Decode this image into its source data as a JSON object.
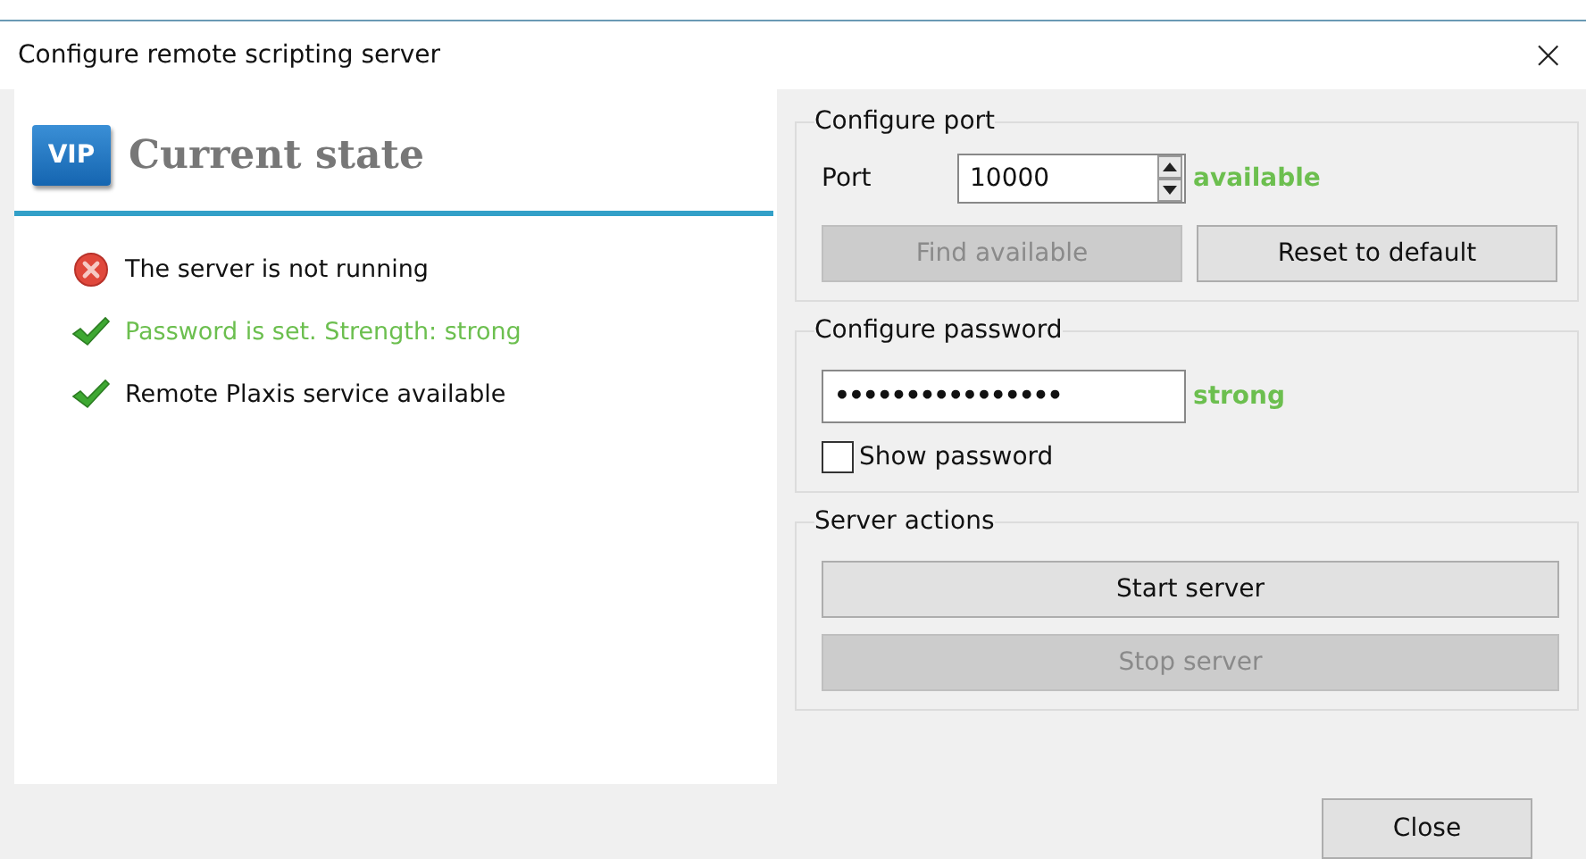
{
  "window": {
    "title": "Configure remote scripting server",
    "close_glyph": "×"
  },
  "current_state": {
    "logo": "VIP",
    "heading": "Current state",
    "items": [
      {
        "kind": "error",
        "text": "The server is not running",
        "highlighted": false
      },
      {
        "kind": "ok",
        "text": "Password is set. Strength: strong",
        "highlighted": true
      },
      {
        "kind": "ok",
        "text": "Remote Plaxis service available",
        "highlighted": false
      }
    ]
  },
  "configure_port": {
    "title": "Configure port",
    "label": "Port",
    "value": "10000",
    "status": "available",
    "buttons": [
      {
        "label": "Find available",
        "disabled": true
      },
      {
        "label": "Reset to default",
        "disabled": false
      }
    ]
  },
  "configure_password": {
    "title": "Configure password",
    "value": "••••••••••••••••",
    "strength": "strong",
    "show_password": {
      "label": "Show password",
      "checked": false
    }
  },
  "server_actions": {
    "title": "Server actions",
    "buttons": [
      {
        "label": "Start server",
        "disabled": false
      },
      {
        "label": "Stop server",
        "disabled": true
      }
    ]
  },
  "footer": {
    "close_button": "Close"
  }
}
